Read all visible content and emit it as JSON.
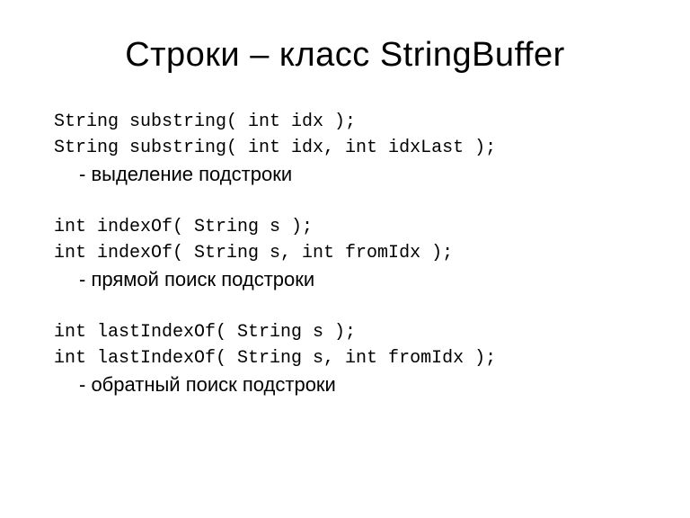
{
  "title": "Строки – класс StringBuffer",
  "blocks": [
    {
      "code1": "String substring( int idx );",
      "code2": "String substring( int idx, int idxLast );",
      "desc": "- выделение подстроки"
    },
    {
      "code1": "int indexOf( String s );",
      "code2": "int indexOf( String s, int fromIdx );",
      "desc": "- прямой поиск подстроки"
    },
    {
      "code1": "int lastIndexOf( String s );",
      "code2": "int lastIndexOf( String s, int fromIdx );",
      "desc": "- обратный поиск подстроки"
    }
  ]
}
